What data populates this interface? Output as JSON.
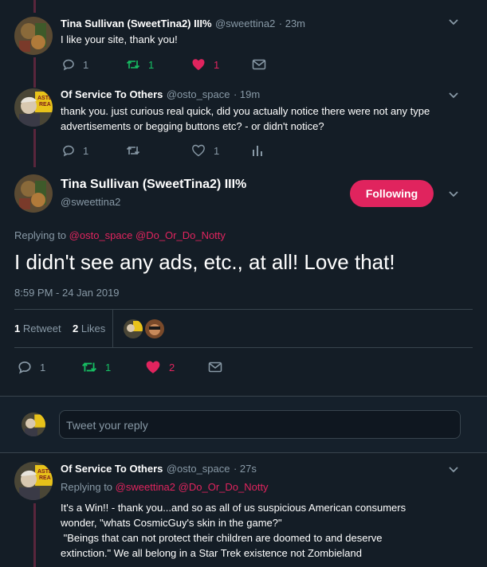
{
  "tweet1": {
    "name": "Tina Sullivan (SweetTina2) III%",
    "handle": "@sweettina2",
    "time": "· 23m",
    "text": "I like your site, thank you!",
    "reply_count": "1",
    "retweet_count": "1",
    "like_count": "1"
  },
  "tweet2": {
    "name": "Of Service To Others",
    "handle": "@osto_space",
    "time": "· 19m",
    "text_line1": "thank you. just curious real quick, did you actually notice there were not any type",
    "text_line2": "advertisements or begging buttons etc? - or didn't notice?",
    "reply_count": "1",
    "like_count": "1"
  },
  "main": {
    "name": "Tina Sullivan (SweetTina2) III%",
    "handle": "@sweettina2",
    "follow_label": "Following",
    "replying_prefix": "Replying to",
    "replying_to_1": "@osto_space",
    "replying_to_2": "@Do_Or_Do_Notty",
    "text": "I didn't see any ads, etc., at all! Love that!",
    "timestamp": "8:59 PM - 24 Jan 2019",
    "retweets_count": "1",
    "retweets_label": "Retweet",
    "likes_count": "2",
    "likes_label": "Likes",
    "reply_count": "1",
    "retweet_count": "1",
    "like_count": "2"
  },
  "reply_box": {
    "placeholder": "Tweet your reply"
  },
  "tweet3": {
    "name": "Of Service To Others",
    "handle": "@osto_space",
    "time": "· 27s",
    "replying_prefix": "Replying to",
    "replying_to_1": "@sweettina2",
    "replying_to_2": "@Do_Or_Do_Notty",
    "line1": "It's a Win!! - thank you...and so as all of us suspicious American consumers",
    "line2": "wonder, \"whats CosmicGuy's skin in the game?\"",
    "line3": " \"Beings that can not protect their children are doomed to and deserve",
    "line4": "extinction.\" We all belong in a Star Trek existence not Zombieland"
  },
  "colors": {
    "background": "#141d26",
    "accent": "#e0245e",
    "retweet_green": "#17bf63",
    "muted": "#8899a6"
  }
}
